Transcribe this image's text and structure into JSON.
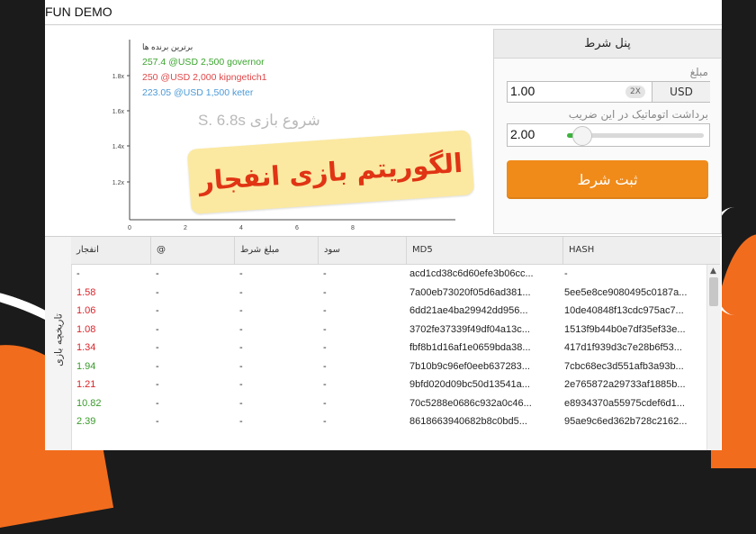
{
  "window": {
    "title": "FUN DEMO"
  },
  "chart": {
    "leaderboard_title": "برترین برنده ها",
    "winners": [
      {
        "text": "257.4 @USD 2,500 governor",
        "color": "#3aa42d"
      },
      {
        "text": "250 @USD 2,000 kipngetich1",
        "color": "#e0484a"
      },
      {
        "text": "223.05 @USD 1,500 keter",
        "color": "#4a9ad8"
      }
    ],
    "countdown": "S. 6.8s شروع بازی",
    "y_ticks": [
      "1.8x",
      "1.6x",
      "1.4x",
      "1.2x"
    ],
    "x_ticks": [
      "0",
      "2",
      "4",
      "6",
      "8"
    ]
  },
  "banner": {
    "text": "الگوریتم بازی انفجار"
  },
  "bet_panel": {
    "title": "پنل شرط",
    "amount_label": "مبلغ",
    "amount_value": "1.00",
    "double_label": "2X",
    "currency": "USD",
    "auto_cashout_label": "برداشت اتوماتیک در این ضریب",
    "auto_cashout_value": "2.00",
    "auto_cashout_slider_fraction": 0.05,
    "place_bet_label": "ثبت شرط"
  },
  "history": {
    "side_label": "تاریخچه بازی",
    "columns": [
      "انفجار",
      "@",
      "مبلغ شرط",
      "سود",
      "MD5",
      "HASH"
    ],
    "rows": [
      {
        "crash": "-",
        "color": "",
        "at": "-",
        "bet": "-",
        "profit": "-",
        "md5": "acd1cd38c6d60efe3b06cc...",
        "hash": "-"
      },
      {
        "crash": "1.58",
        "color": "red",
        "at": "-",
        "bet": "-",
        "profit": "-",
        "md5": "7a00eb73020f05d6ad381...",
        "hash": "5ee5e8ce9080495c0187a..."
      },
      {
        "crash": "1.06",
        "color": "red",
        "at": "-",
        "bet": "-",
        "profit": "-",
        "md5": "6dd21ae4ba29942dd956...",
        "hash": "10de40848f13cdc975ac7..."
      },
      {
        "crash": "1.08",
        "color": "red",
        "at": "-",
        "bet": "-",
        "profit": "-",
        "md5": "3702fe37339f49df04a13c...",
        "hash": "1513f9b44b0e7df35ef33e..."
      },
      {
        "crash": "1.34",
        "color": "red",
        "at": "-",
        "bet": "-",
        "profit": "-",
        "md5": "fbf8b1d16af1e0659bda38...",
        "hash": "417d1f939d3c7e28b6f53..."
      },
      {
        "crash": "1.94",
        "color": "green",
        "at": "-",
        "bet": "-",
        "profit": "-",
        "md5": "7b10b9c96ef0eeb637283...",
        "hash": "7cbc68ec3d551afb3a93b..."
      },
      {
        "crash": "1.21",
        "color": "red",
        "at": "-",
        "bet": "-",
        "profit": "-",
        "md5": "9bfd020d09bc50d13541a...",
        "hash": "2e765872a29733af1885b..."
      },
      {
        "crash": "10.82",
        "color": "green",
        "at": "-",
        "bet": "-",
        "profit": "-",
        "md5": "70c5288e0686c932a0c46...",
        "hash": "e8934370a55975cdef6d1..."
      },
      {
        "crash": "2.39",
        "color": "green",
        "at": "-",
        "bet": "-",
        "profit": "-",
        "md5": "8618663940682b8c0bd5...",
        "hash": "95ae9c6ed362b728c2162..."
      }
    ]
  }
}
